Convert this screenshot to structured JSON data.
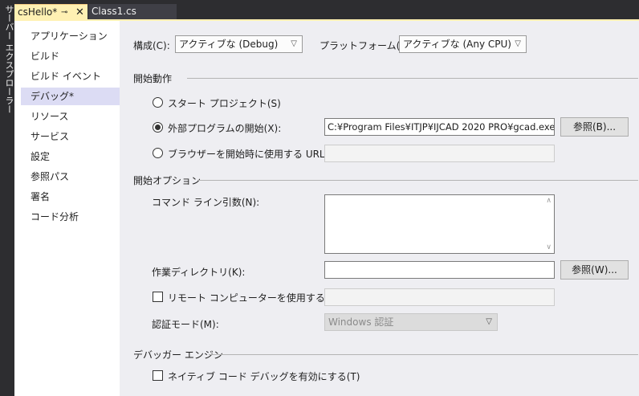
{
  "explorer_strip": {
    "label": "サーバー エクスプローラー"
  },
  "tabs": [
    {
      "label": "csHello*",
      "pin_icon": "pin-icon",
      "close_icon": "close-icon",
      "active": true
    },
    {
      "label": "Class1.cs",
      "active": false
    }
  ],
  "nav": {
    "items": [
      {
        "label": "アプリケーション"
      },
      {
        "label": "ビルド"
      },
      {
        "label": "ビルド イベント"
      },
      {
        "label": "デバッグ*"
      },
      {
        "label": "リソース"
      },
      {
        "label": "サービス"
      },
      {
        "label": "設定"
      },
      {
        "label": "参照パス"
      },
      {
        "label": "署名"
      },
      {
        "label": "コード分析"
      }
    ],
    "selected_index": 3
  },
  "config": {
    "config_label": "構成(C):",
    "config_value": "アクティブな (Debug)",
    "platform_label": "プラットフォーム(M):",
    "platform_value": "アクティブな (Any CPU)"
  },
  "start_action": {
    "heading": "開始動作",
    "start_project_label": "スタート プロジェクト(S)",
    "external_program_label": "外部プログラムの開始(X):",
    "external_program_value": "C:¥Program Files¥ITJP¥IJCAD 2020 PRO¥gcad.exe",
    "browse_label": "参照(B)...",
    "browser_url_label": "ブラウザーを開始時に使用する URL(R):",
    "browser_url_value": "",
    "selected": "external_program"
  },
  "start_options": {
    "heading": "開始オプション",
    "cmdline_label": "コマンド ライン引数(N):",
    "cmdline_value": "",
    "workdir_label": "作業ディレクトリ(K):",
    "workdir_value": "",
    "workdir_browse_label": "参照(W)...",
    "remote_label": "リモート コンピューターを使用する(A)",
    "remote_checked": false,
    "remote_value": "",
    "auth_label": "認証モード(M):",
    "auth_value": "Windows 認証"
  },
  "debugger_engines": {
    "heading": "デバッガー エンジン",
    "native_label": "ネイティブ コード デバッグを有効にする(T)",
    "native_checked": false
  }
}
